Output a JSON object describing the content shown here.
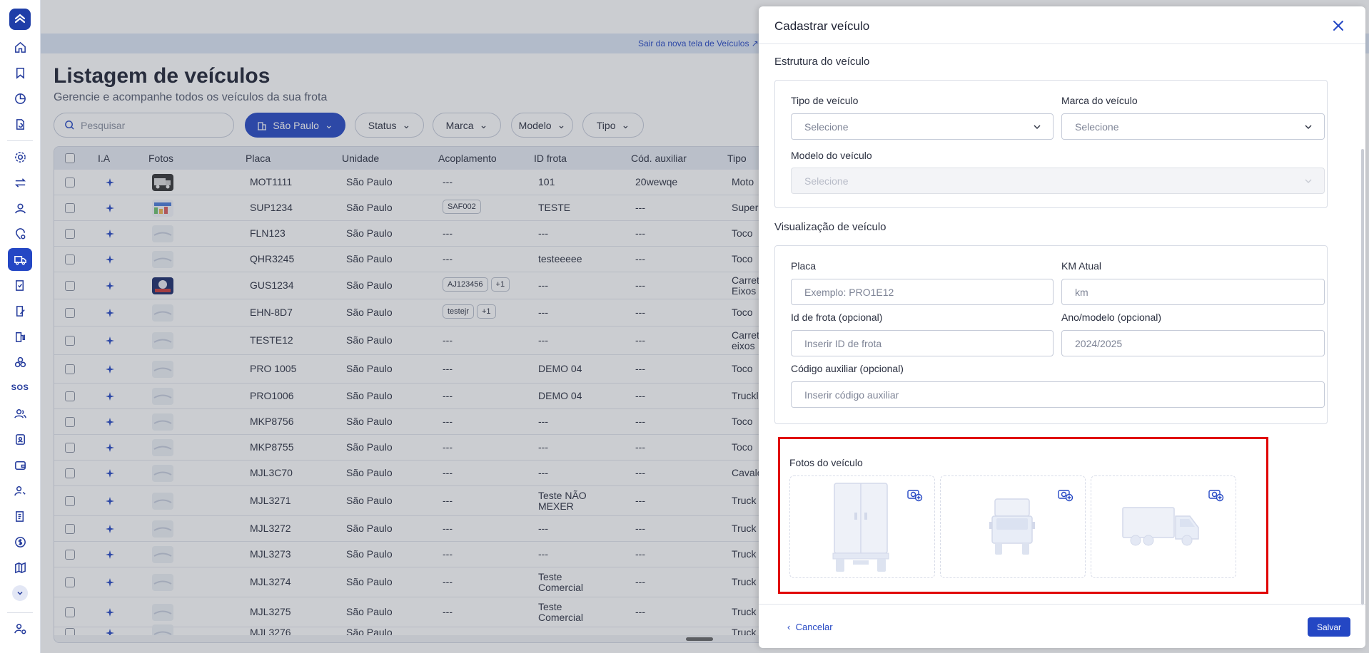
{
  "sidebar": {
    "items": [
      {
        "icon": "home-icon"
      },
      {
        "icon": "bookmark-icon"
      },
      {
        "icon": "pie-chart-icon"
      },
      {
        "icon": "document-refresh-icon"
      },
      {
        "icon": "gear-icon"
      },
      {
        "icon": "transfer-arrows-icon"
      },
      {
        "icon": "user-icon"
      },
      {
        "icon": "location-gear-icon"
      },
      {
        "icon": "truck-icon",
        "active": true
      },
      {
        "icon": "checklist-icon"
      },
      {
        "icon": "document-edit-icon"
      },
      {
        "icon": "fuel-pump-icon"
      },
      {
        "icon": "tires-icon"
      },
      {
        "icon": "sos-icon",
        "text": "SOS"
      },
      {
        "icon": "users-icon"
      },
      {
        "icon": "id-badge-icon"
      },
      {
        "icon": "wallet-icon"
      },
      {
        "icon": "user-key-icon"
      },
      {
        "icon": "contract-icon"
      },
      {
        "icon": "dollar-icon"
      },
      {
        "icon": "map-icon"
      }
    ],
    "accent": "#2447c4"
  },
  "topbar": {
    "link_label": "Sair da nova tela de Veículos"
  },
  "page": {
    "title": "Listagem de veículos",
    "subtitle": "Gerencie e acompanhe todos os veículos da sua frota"
  },
  "filters": {
    "search_placeholder": "Pesquisar",
    "unit": "São Paulo",
    "status": "Status",
    "brand": "Marca",
    "model": "Modelo",
    "type": "Tipo"
  },
  "table": {
    "columns": [
      "I.A",
      "Fotos",
      "Placa",
      "Unidade",
      "Acoplamento",
      "ID frota",
      "Cód. auxiliar",
      "Tipo"
    ],
    "rows": [
      {
        "placa": "MOT1111",
        "unidade": "São Paulo",
        "acoplamento": "---",
        "id_frota": "101",
        "cod_aux": "20wewqe",
        "tipo": "Moto",
        "photo": "truck-photo"
      },
      {
        "placa": "SUP1234",
        "unidade": "São Paulo",
        "tags": [
          "SAF002"
        ],
        "id_frota": "TESTE",
        "cod_aux": "---",
        "tipo": "Super",
        "photo": "chart-photo"
      },
      {
        "placa": "FLN123",
        "unidade": "São Paulo",
        "acoplamento": "---",
        "id_frota": "---",
        "cod_aux": "---",
        "tipo": "Toco"
      },
      {
        "placa": "QHR3245",
        "unidade": "São Paulo",
        "acoplamento": "---",
        "id_frota": "testeeeee",
        "cod_aux": "---",
        "tipo": "Toco"
      },
      {
        "placa": "GUS1234",
        "unidade": "São Paulo",
        "tags": [
          "AJ123456",
          "+1"
        ],
        "id_frota": "---",
        "cod_aux": "---",
        "tipo": "Carret",
        "tipo2": "Eixos",
        "photo": "poster-photo"
      },
      {
        "placa": "EHN-8D7",
        "unidade": "São Paulo",
        "tags": [
          "testejr",
          "+1"
        ],
        "id_frota": "---",
        "cod_aux": "---",
        "tipo": "Toco"
      },
      {
        "placa": "TESTE12",
        "unidade": "São Paulo",
        "acoplamento": "---",
        "id_frota": "---",
        "cod_aux": "---",
        "tipo": "Carret",
        "tipo2": "eixos"
      },
      {
        "placa": "PRO 1005",
        "unidade": "São Paulo",
        "acoplamento": "---",
        "id_frota": "DEMO 04",
        "cod_aux": "---",
        "tipo": "Toco"
      },
      {
        "placa": "PRO1006",
        "unidade": "São Paulo",
        "acoplamento": "---",
        "id_frota": "DEMO 04",
        "cod_aux": "---",
        "tipo": "Truckl"
      },
      {
        "placa": "MKP8756",
        "unidade": "São Paulo",
        "acoplamento": "---",
        "id_frota": "---",
        "cod_aux": "---",
        "tipo": "Toco"
      },
      {
        "placa": "MKP8755",
        "unidade": "São Paulo",
        "acoplamento": "---",
        "id_frota": "---",
        "cod_aux": "---",
        "tipo": "Toco"
      },
      {
        "placa": "MJL3C70",
        "unidade": "São Paulo",
        "acoplamento": "---",
        "id_frota": "---",
        "cod_aux": "---",
        "tipo": "Cavalo"
      },
      {
        "placa": "MJL3271",
        "unidade": "São Paulo",
        "acoplamento": "---",
        "id_frota": "Teste NÃO",
        "id_frota2": "MEXER",
        "cod_aux": "---",
        "tipo": "Truck"
      },
      {
        "placa": "MJL3272",
        "unidade": "São Paulo",
        "acoplamento": "---",
        "id_frota": "---",
        "cod_aux": "---",
        "tipo": "Truck"
      },
      {
        "placa": "MJL3273",
        "unidade": "São Paulo",
        "acoplamento": "---",
        "id_frota": "---",
        "cod_aux": "---",
        "tipo": "Truck"
      },
      {
        "placa": "MJL3274",
        "unidade": "São Paulo",
        "acoplamento": "---",
        "id_frota": "Teste",
        "id_frota2": "Comercial",
        "cod_aux": "---",
        "tipo": "Truck"
      },
      {
        "placa": "MJL3275",
        "unidade": "São Paulo",
        "acoplamento": "---",
        "id_frota": "Teste",
        "id_frota2": "Comercial",
        "cod_aux": "---",
        "tipo": "Truck"
      },
      {
        "placa": "MJL3276",
        "unidade": "São Paulo",
        "acoplamento": "",
        "id_frota": "",
        "cod_aux": "",
        "tipo": "Truck"
      }
    ]
  },
  "drawer": {
    "title": "Cadastrar veículo",
    "structure": {
      "title": "Estrutura do veículo",
      "tipo_label": "Tipo de veículo",
      "tipo_value": "Selecione",
      "marca_label": "Marca do veículo",
      "marca_value": "Selecione",
      "modelo_label": "Modelo do veículo",
      "modelo_value": "Selecione"
    },
    "visual": {
      "title": "Visualização de veículo",
      "placa_label": "Placa",
      "placa_placeholder": "Exemplo: PRO1E12",
      "km_label": "KM Atual",
      "km_placeholder": "km",
      "frota_label": "Id de frota (opcional)",
      "frota_placeholder": "Inserir ID de frota",
      "ano_label": "Ano/modelo (opcional)",
      "ano_placeholder": "2024/2025",
      "cod_label": "Código auxiliar (opcional)",
      "cod_placeholder": "Inserir código auxiliar"
    },
    "photos": {
      "title": "Fotos do veículo",
      "slots": [
        "truck-back-icon",
        "truck-front-icon",
        "truck-side-icon"
      ]
    },
    "cancel": "Cancelar",
    "save": "Salvar"
  }
}
